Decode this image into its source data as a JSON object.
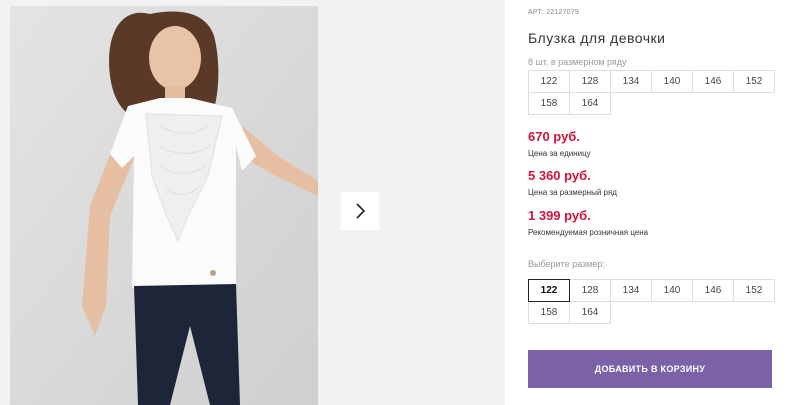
{
  "gallery": {
    "next_icon": "chevron-right-icon"
  },
  "product": {
    "article": "АРТ: 22127079",
    "title": "Блузка для девочки",
    "pack_text": "8 шт. в размерном ряду",
    "pack_sizes": [
      "122",
      "128",
      "134",
      "140",
      "146",
      "152",
      "158",
      "164"
    ],
    "prices": [
      {
        "value": "670 руб.",
        "label": "Цена за единицу"
      },
      {
        "value": "5 360 руб.",
        "label": "Цена за размерный ряд"
      },
      {
        "value": "1 399 руб.",
        "label": "Рекомендуемая розничная цена"
      }
    ],
    "price_color": "#d0133a"
  },
  "size_select": {
    "label": "Выберите размер:",
    "options": [
      "122",
      "128",
      "134",
      "140",
      "146",
      "152",
      "158",
      "164"
    ],
    "selected": "122"
  },
  "cart": {
    "add_label": "ДОБАВИТЬ В КОРЗИНУ",
    "button_color": "#7b62a8"
  }
}
